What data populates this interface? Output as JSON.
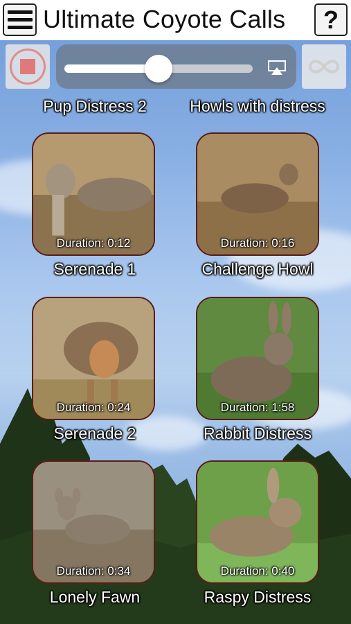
{
  "header": {
    "title": "Ultimate Coyote Calls",
    "help_label": "?"
  },
  "player": {
    "volume_fraction": 0.5
  },
  "top_labels": [
    "Pup Distress 2",
    "Howls with distress"
  ],
  "calls": [
    {
      "name": "Serenade 1",
      "duration": "Duration: 0:12",
      "image": "coyote-in-grass"
    },
    {
      "name": "Challenge Howl",
      "duration": "Duration: 0:16",
      "image": "coyote-in-grass"
    },
    {
      "name": "Serenade 2",
      "duration": "Duration: 0:24",
      "image": "coyote-facing-front"
    },
    {
      "name": "Rabbit Distress",
      "duration": "Duration: 1:58",
      "image": "rabbit-in-grass"
    },
    {
      "name": "Lonely Fawn",
      "duration": "Duration: 0:34",
      "image": "fawn-in-grass"
    },
    {
      "name": "Raspy Distress",
      "duration": "Duration: 0:40",
      "image": "rabbit-in-grass"
    }
  ],
  "colors": {
    "card_border": "#5a1c14",
    "stop_red": "#e07a7a",
    "topbar": "#ffffff"
  }
}
